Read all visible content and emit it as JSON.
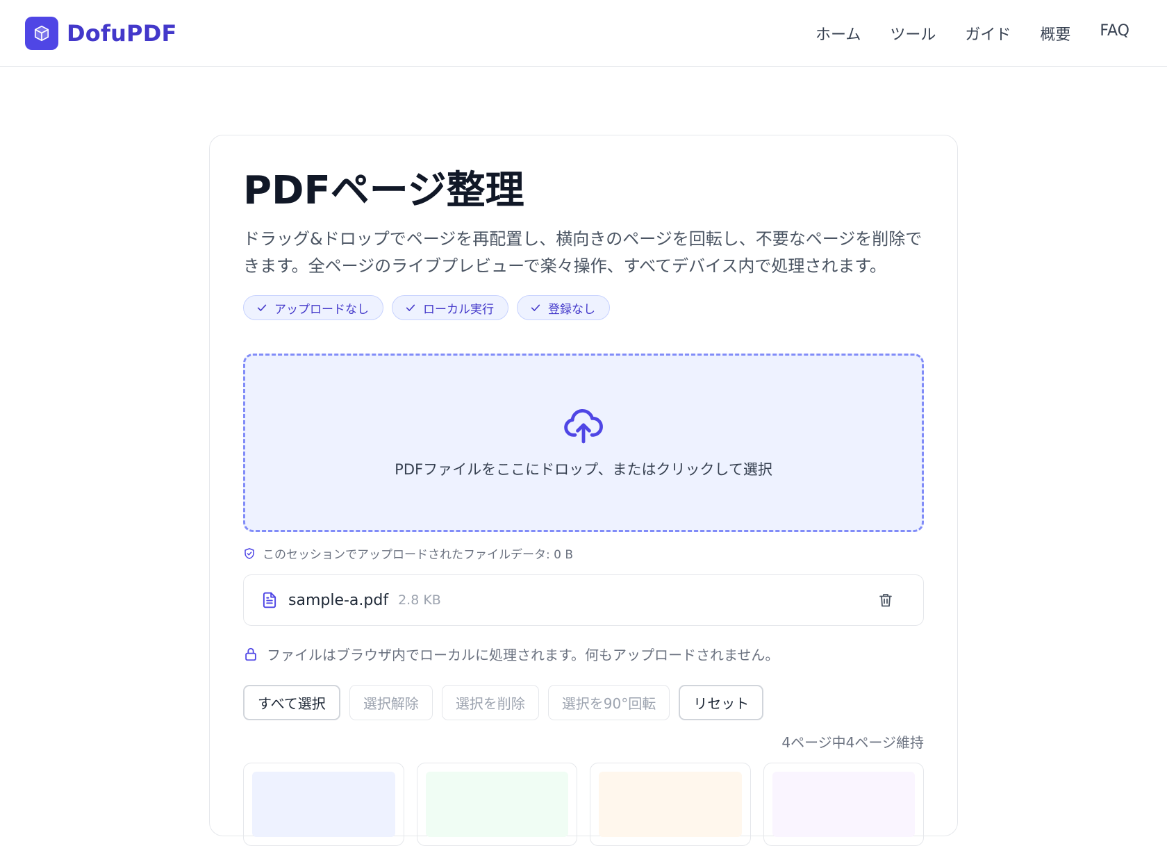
{
  "brand": {
    "name": "DofuPDF",
    "accent": "#4f46e5"
  },
  "nav": [
    {
      "label": "ホーム"
    },
    {
      "label": "ツール"
    },
    {
      "label": "ガイド"
    },
    {
      "label": "概要"
    },
    {
      "label": "FAQ"
    }
  ],
  "tool": {
    "title": "PDFページ整理",
    "description": "ドラッグ&ドロップでページを再配置し、横向きのページを回転し、不要なページを削除できます。全ページのライブプレビューで楽々操作、すべてデバイス内で処理されます。",
    "badges": [
      {
        "label": "アップロードなし",
        "icon": "check-icon"
      },
      {
        "label": "ローカル実行",
        "icon": "check-icon"
      },
      {
        "label": "登録なし",
        "icon": "check-icon"
      }
    ]
  },
  "dropzone": {
    "text": "PDFファイルをここにドロップ、またはクリックして選択",
    "icon": "cloud-upload-icon"
  },
  "session_note": "このセッションでアップロードされたファイルデータ: 0 B",
  "file": {
    "name": "sample-a.pdf",
    "size": "2.8 KB"
  },
  "local_note": "ファイルはブラウザ内でローカルに処理されます。何もアップロードされません。",
  "toolbar": {
    "select_all": "すべて選択",
    "deselect": "選択解除",
    "delete_selected": "選択を削除",
    "rotate_selected": "選択を90°回転",
    "reset": "リセット"
  },
  "page_count": "4ページ中4ページ維持",
  "thumbnail_colors": [
    "#eef2ff",
    "#f0fdf4",
    "#fff7ed",
    "#faf5ff"
  ]
}
